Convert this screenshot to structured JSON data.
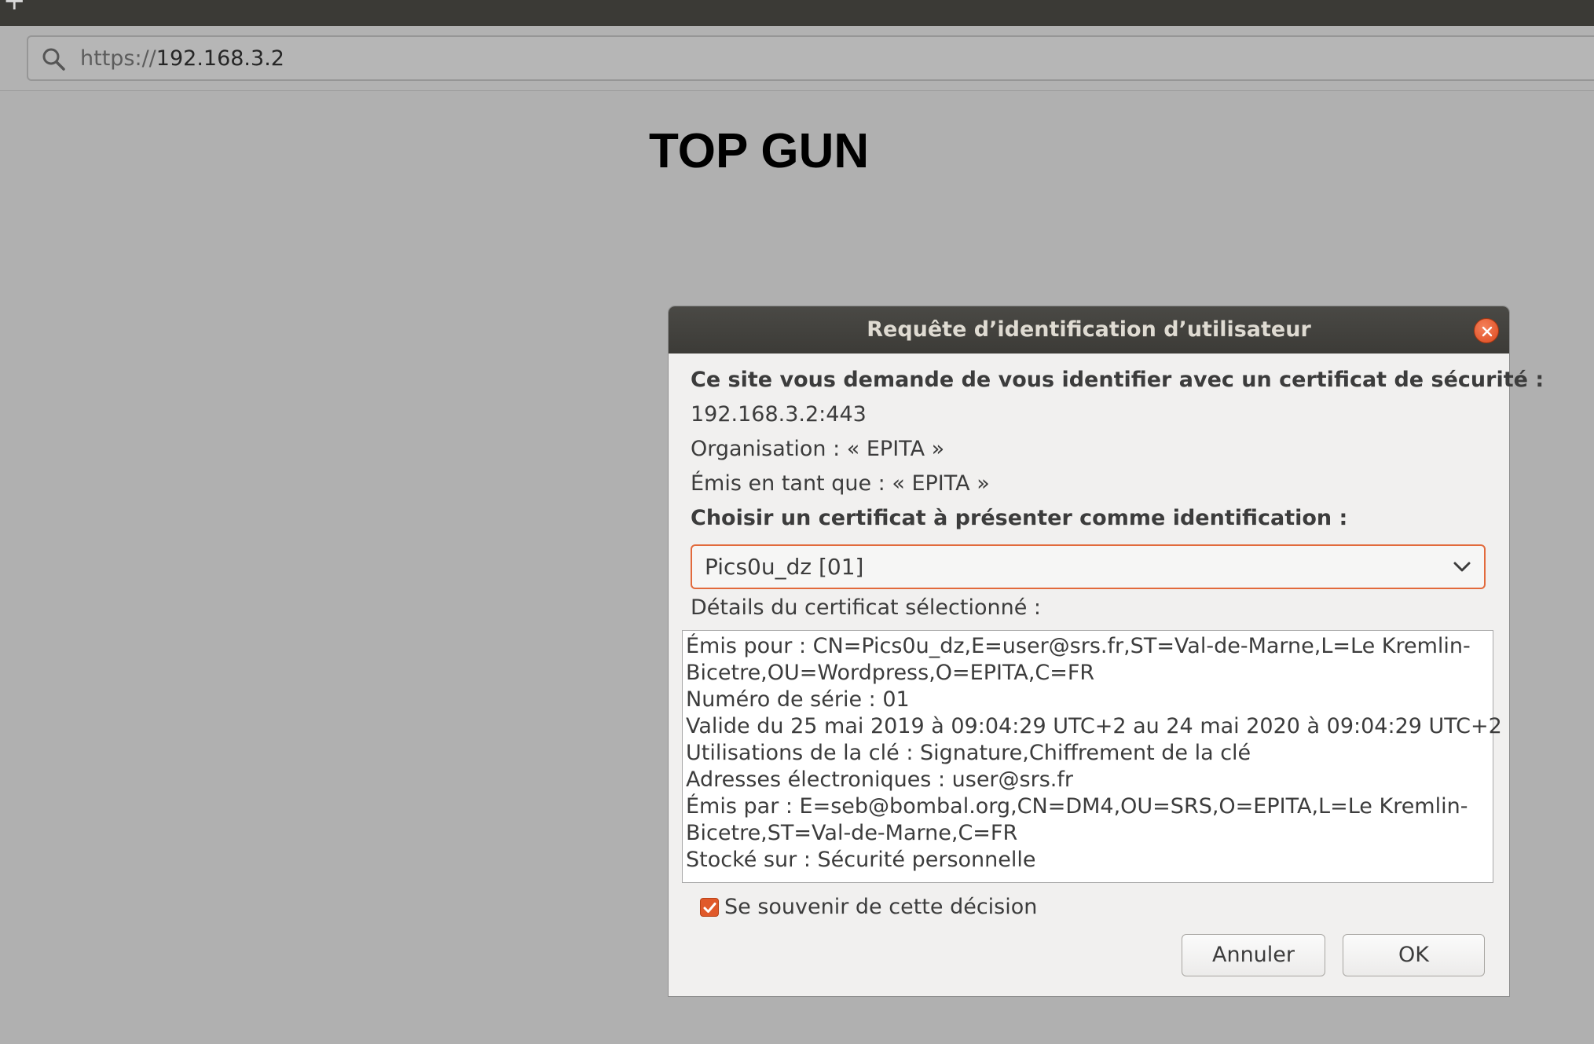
{
  "browser": {
    "new_tab_glyph": "+",
    "url_scheme": "https://",
    "url_host": "192.168.3.2",
    "search_icon": "search-icon"
  },
  "page": {
    "title": "TOP GUN"
  },
  "dialog": {
    "title": "Requête d’identification d’utilisateur",
    "close_icon": "close-icon",
    "intro": "Ce site vous demande de vous identifier avec un certificat de sécurité :",
    "host": "192.168.3.2:443",
    "organisation": "Organisation : « EPITA »",
    "issued_as": "Émis en tant que : « EPITA »",
    "choose_label": "Choisir un certificat à présenter comme identification :",
    "selected_certificate": "Pics0u_dz [01]",
    "details_label": "Détails du certificat sélectionné :",
    "details_lines": [
      "Émis pour : CN=Pics0u_dz,E=user@srs.fr,ST=Val-de-Marne,L=Le Kremlin-",
      "Bicetre,OU=Wordpress,O=EPITA,C=FR",
      "Numéro de série : 01",
      "Valide du 25 mai 2019 à 09:04:29 UTC+2 au 24 mai 2020 à 09:04:29 UTC+2",
      "Utilisations de la clé : Signature,Chiffrement de la clé",
      "Adresses électroniques : user@srs.fr",
      "Émis par : E=seb@bombal.org,CN=DM4,OU=SRS,O=EPITA,L=Le Kremlin-",
      "Bicetre,ST=Val-de-Marne,C=FR",
      "Stocké sur : Sécurité personnelle"
    ],
    "remember_label": "Se souvenir de cette décision",
    "remember_checked": true,
    "cancel_label": "Annuler",
    "ok_label": "OK"
  },
  "colors": {
    "accent": "#e0592a",
    "titlebar": "#3c3b37",
    "background": "#b0b0b0"
  }
}
